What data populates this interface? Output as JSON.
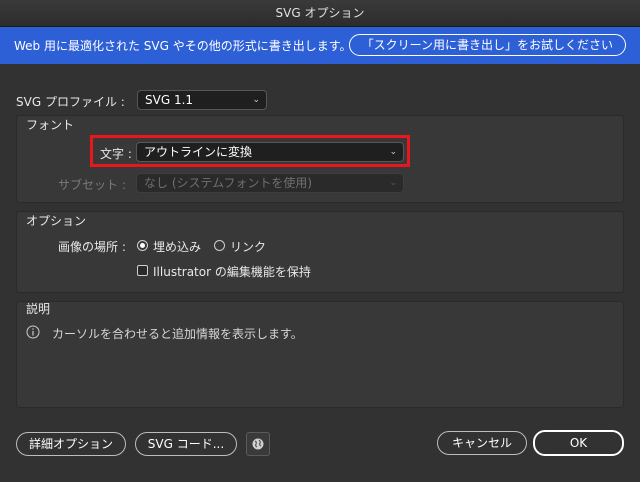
{
  "window": {
    "title": "SVG オプション"
  },
  "banner": {
    "text": "Web 用に最適化された SVG やその他の形式に書き出します。",
    "button_label": "「スクリーン用に書き出し」をお試しください"
  },
  "profile": {
    "label": "SVG プロファイル :",
    "value": "SVG 1.1"
  },
  "font_group": {
    "title": "フォント",
    "type_label": "文字 :",
    "type_value": "アウトラインに変換",
    "subset_label": "サブセット :",
    "subset_value": "なし (システムフォントを使用)"
  },
  "options_group": {
    "title": "オプション",
    "image_location_label": "画像の場所 :",
    "embed_label": "埋め込み",
    "link_label": "リンク",
    "embed_selected": true,
    "preserve_label": "Illustrator の編集機能を保持",
    "preserve_checked": false
  },
  "description_group": {
    "title": "説明",
    "text": "カーソルを合わせると追加情報を表示します。"
  },
  "footer": {
    "more_options_label": "詳細オプション",
    "svg_code_label": "SVG コード...",
    "cancel_label": "キャンセル",
    "ok_label": "OK"
  },
  "colors": {
    "banner": "#2d5fd6",
    "background": "#323232",
    "highlight": "#e8161d"
  }
}
